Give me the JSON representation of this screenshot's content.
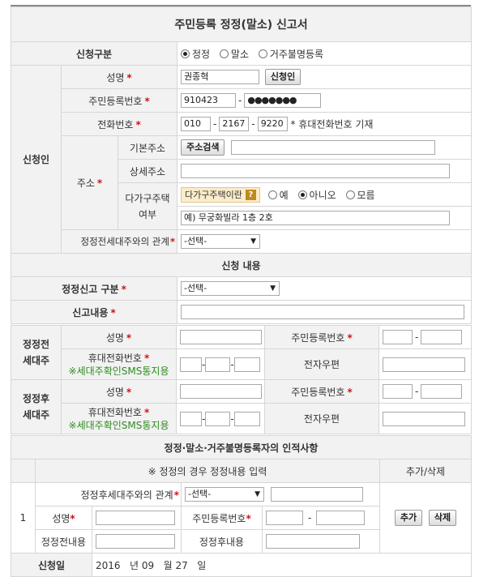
{
  "title": "주민등록 정정(말소) 신고서",
  "type_row": {
    "label": "신청구분",
    "options": [
      {
        "label": "정정",
        "selected": true
      },
      {
        "label": "말소",
        "selected": false
      },
      {
        "label": "거주불명등록",
        "selected": false
      }
    ]
  },
  "applicant": {
    "section_label": "신청인",
    "name_label": "성명",
    "name_value": "권종혁",
    "name_button": "신청인",
    "rrn_label": "주민등록번호",
    "rrn_front": "910423",
    "rrn_back": "●●●●●●●",
    "phone_label": "전화번호",
    "phone_1": "010",
    "phone_2": "2167",
    "phone_3": "9220",
    "phone_note": "* 휴대전화번호 기재",
    "address_label": "주소",
    "basic_address_label": "기본주소",
    "address_search_button": "주소검색",
    "basic_address_value": "",
    "detail_address_label": "상세주소",
    "detail_address_value": "",
    "multi_house_label_1": "다가구주택",
    "multi_house_label_2": "여부",
    "multi_house_help": "다가구주택이란",
    "multi_house_help_icon": "?",
    "multi_house_options": [
      {
        "label": "예",
        "selected": false
      },
      {
        "label": "아니오",
        "selected": true
      },
      {
        "label": "모름",
        "selected": false
      }
    ],
    "multi_house_example": "예) 무궁화빌라 1층 2호",
    "relation_label": "정정전세대주와의 관계",
    "relation_value": "-선택-"
  },
  "request": {
    "section_title": "신청 내용",
    "type_label": "정정신고 구분",
    "type_value": "-선택-",
    "content_label": "신고내용",
    "content_value": ""
  },
  "before_head": {
    "label_1": "정정전",
    "label_2": "세대주",
    "name_label": "성명",
    "rrn_label": "주민등록번호",
    "mobile_label": "휴대전화번호",
    "sms_note": "※세대주확인SMS통지용",
    "email_label": "전자우편"
  },
  "after_head": {
    "label_1": "정정후",
    "label_2": "세대주",
    "name_label": "성명",
    "rrn_label": "주민등록번호",
    "mobile_label": "휴대전화번호",
    "sms_note": "※세대주확인SMS통지용",
    "email_label": "전자우편"
  },
  "persons": {
    "section_title": "정정·말소·거주불명등록자의 인적사항",
    "note": "※ 정정의 경우 정정내용 입력",
    "add_delete_header": "추가/삭제",
    "row_number": "1",
    "relation_label": "정정후세대주와의 관계",
    "relation_value": "-선택-",
    "name_label": "성명",
    "rrn_label": "주민등록번호",
    "before_label": "정정전내용",
    "after_label": "정정후내용",
    "add_button": "추가",
    "delete_button": "삭제"
  },
  "date_row": {
    "label": "신청일",
    "year": "2016",
    "year_unit": "년",
    "month": "09",
    "month_unit": "월",
    "day": "27",
    "day_unit": "일"
  }
}
